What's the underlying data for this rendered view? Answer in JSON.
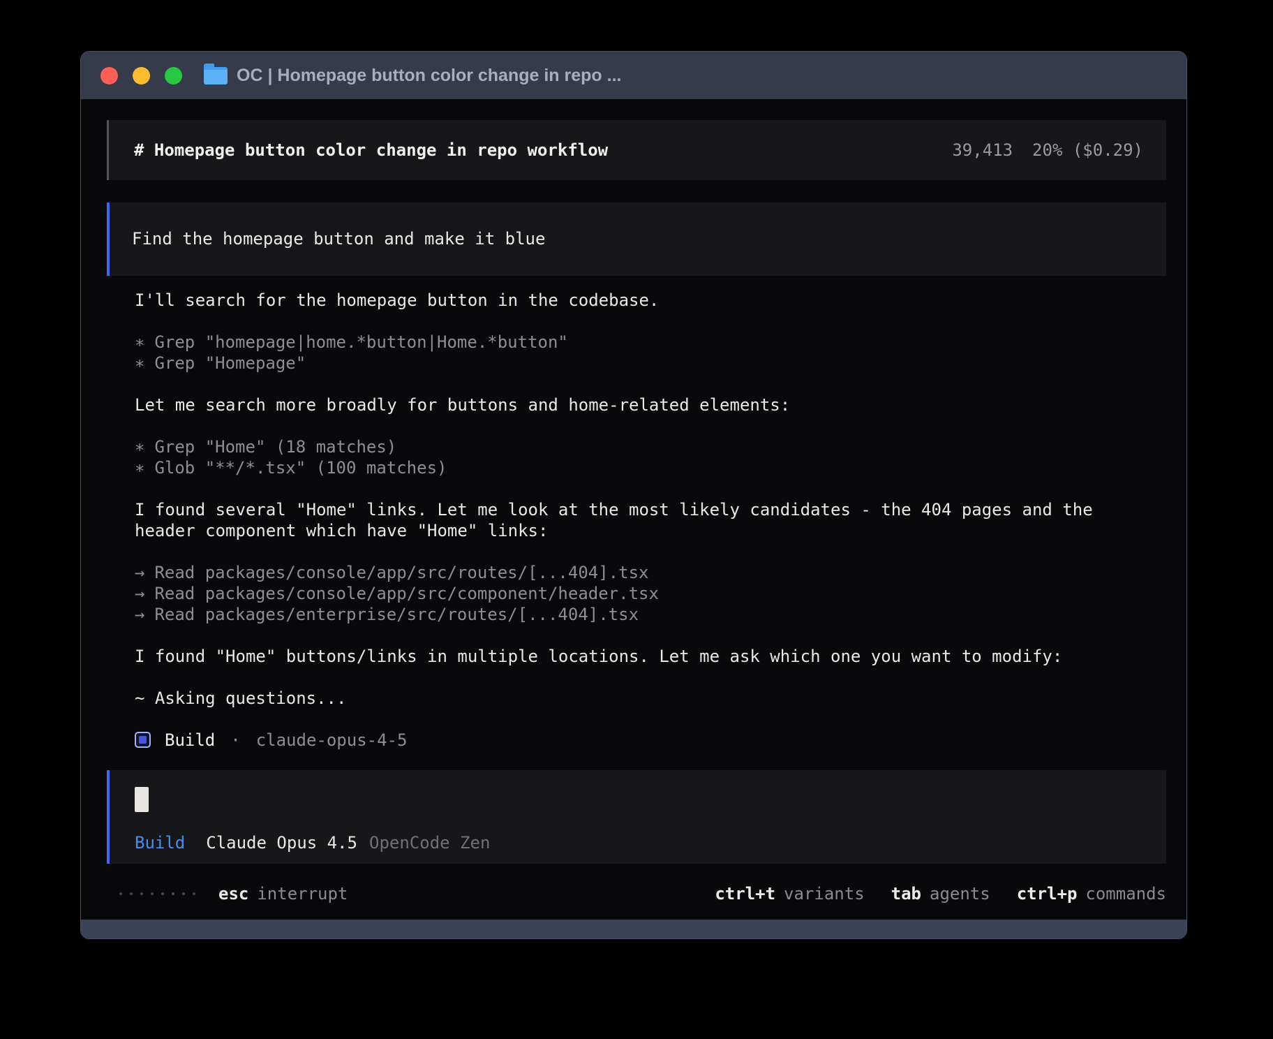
{
  "window": {
    "title": "OC | Homepage button color change in repo ...",
    "traffic_lights": {
      "close": "#ff5f57",
      "minimize": "#febc2e",
      "zoom": "#28c840"
    }
  },
  "header": {
    "title": "# Homepage button color change in repo workflow",
    "tokens": "39,413",
    "context": "20% ($0.29)"
  },
  "user_message": {
    "text": "Find the homepage button and make it blue"
  },
  "assistant": {
    "p1": "I'll search for the homepage button in the codebase.",
    "tools1": [
      {
        "prefix": "∗",
        "text": "Grep \"homepage|home.*button|Home.*button\""
      },
      {
        "prefix": "∗",
        "text": "Grep \"Homepage\""
      }
    ],
    "p2": "Let me search more broadly for buttons and home-related elements:",
    "tools2": [
      {
        "prefix": "∗",
        "text": "Grep \"Home\" (18 matches)"
      },
      {
        "prefix": "∗",
        "text": "Glob \"**/*.tsx\" (100 matches)"
      }
    ],
    "p3": "I found several \"Home\" links. Let me look at the most likely candidates - the 404 pages and the header component which have \"Home\" links:",
    "reads": [
      {
        "prefix": "→",
        "text": "Read packages/console/app/src/routes/[...404].tsx"
      },
      {
        "prefix": "→",
        "text": "Read packages/console/app/src/component/header.tsx"
      },
      {
        "prefix": "→",
        "text": "Read packages/enterprise/src/routes/[...404].tsx"
      }
    ],
    "p4": "I found \"Home\" buttons/links in multiple locations. Let me ask which one you want to modify:",
    "p5": "~ Asking questions...",
    "task": {
      "label": "Build",
      "separator": "·",
      "model": "claude-opus-4-5"
    }
  },
  "input": {
    "status": {
      "mode": "Build",
      "model": "Claude Opus 4.5",
      "provider": "OpenCode Zen"
    }
  },
  "footer": {
    "interrupt": {
      "key": "esc",
      "label": "interrupt"
    },
    "shortcuts": [
      {
        "key": "ctrl+t",
        "label": "variants"
      },
      {
        "key": "tab",
        "label": "agents"
      },
      {
        "key": "ctrl+p",
        "label": "commands"
      }
    ]
  },
  "colors": {
    "accent_blue_border": "#3f66f5",
    "status_mode_blue": "#4a8df0",
    "titlebar": "#353b4a",
    "block_bg": "#17171a",
    "terminal_bg": "#09090b",
    "gray_text": "#8e8e93",
    "build_icon_border": "#a9b1f6",
    "build_icon_fill": "#4556e0"
  }
}
